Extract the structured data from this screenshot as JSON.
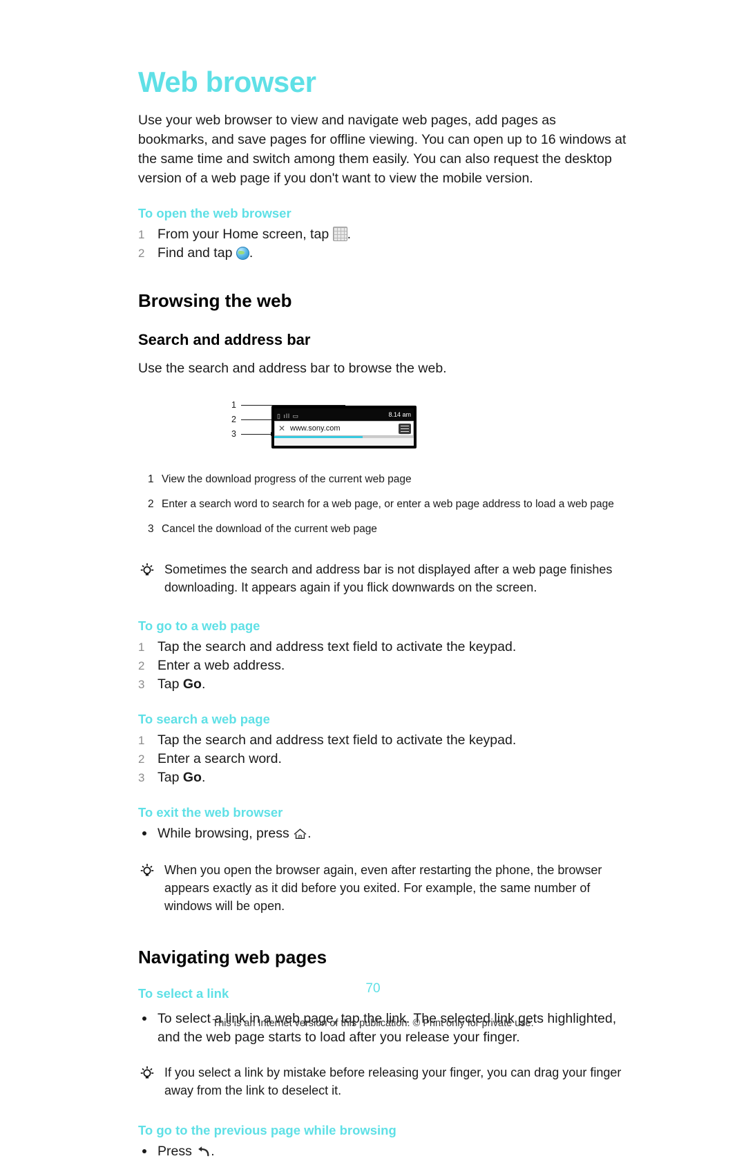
{
  "document": {
    "title": "Web browser",
    "intro": "Use your web browser to view and navigate web pages, add pages as bookmarks, and save pages for offline viewing. You can open up to 16 windows at the same time and switch among them easily. You can also request the desktop version of a web page if you don't want to view the mobile version.",
    "page_number": "70",
    "footer": "This is an Internet version of this publication. © Print only for private use."
  },
  "procedures": {
    "open_browser": {
      "heading": "To open the web browser",
      "steps": [
        {
          "num": "1",
          "text_before": "From your Home screen, tap",
          "icon": "apps-grid-icon",
          "text_after": "."
        },
        {
          "num": "2",
          "text_before": "Find and tap",
          "icon": "browser-globe-icon",
          "text_after": "."
        }
      ]
    },
    "go_to_web_page": {
      "heading": "To go to a web page",
      "steps": [
        {
          "num": "1",
          "text": "Tap the search and address text field to activate the keypad."
        },
        {
          "num": "2",
          "text": "Enter a web address."
        },
        {
          "num": "3",
          "text_before": "Tap ",
          "bold": "Go",
          "text_after": "."
        }
      ]
    },
    "search_web_page": {
      "heading": "To search a web page",
      "steps": [
        {
          "num": "1",
          "text": "Tap the search and address text field to activate the keypad."
        },
        {
          "num": "2",
          "text": "Enter a search word."
        },
        {
          "num": "3",
          "text_before": "Tap ",
          "bold": "Go",
          "text_after": "."
        }
      ]
    },
    "exit_browser": {
      "heading": "To exit the web browser",
      "bullet_before": "While browsing, press",
      "icon": "home-key-icon",
      "bullet_after": "."
    },
    "select_link": {
      "heading": "To select a link",
      "bullet": "To select a link in a web page, tap the link. The selected link gets highlighted, and the web page starts to load after you release your finger."
    },
    "previous_page": {
      "heading": "To go to the previous page while browsing",
      "bullet_before": "Press",
      "icon": "back-key-icon",
      "bullet_after": "."
    }
  },
  "sections": {
    "browsing_the_web": "Browsing the web",
    "search_and_address_bar": "Search and address bar",
    "search_and_address_bar_body": "Use the search and address bar to browse the web.",
    "navigating_web_pages": "Navigating web pages"
  },
  "figure": {
    "callouts": [
      "1",
      "2",
      "3"
    ],
    "phone": {
      "status_time": "8.14 am",
      "url_value": "www.sony.com",
      "close_icon": "close-x-icon",
      "menu_icon": "menu-bookmarks-icon",
      "progress_percent": 63
    },
    "captions": [
      {
        "n": "1",
        "text": "View the download progress of the current web page"
      },
      {
        "n": "2",
        "text": "Enter a search word to search for a web page, or enter a web page address to load a web page"
      },
      {
        "n": "3",
        "text": "Cancel the download of the current web page"
      }
    ]
  },
  "tips": [
    "Sometimes the search and address bar is not displayed after a web page finishes downloading. It appears again if you flick downwards on the screen.",
    "When you open the browser again, even after restarting the phone, the browser appears exactly as it did before you exited. For example, the same number of windows will be open.",
    "If you select a link by mistake before releasing your finger, you can drag your finger away from the link to deselect it."
  ],
  "colors": {
    "accent": "#5fe0e6",
    "progress": "#37c9e0",
    "text": "#1a1a1a"
  }
}
